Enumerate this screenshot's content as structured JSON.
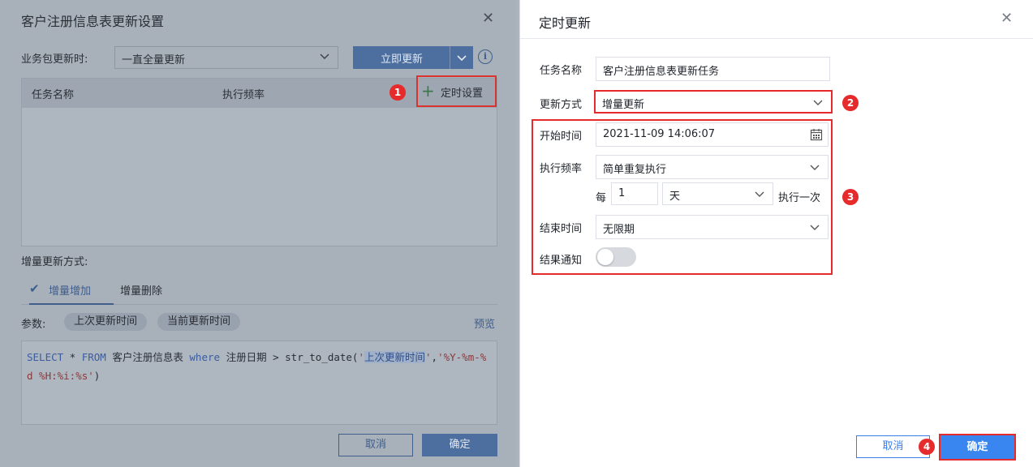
{
  "left_dialog": {
    "title": "客户注册信息表更新设置",
    "update_label": "业务包更新时:",
    "update_select_value": "一直全量更新",
    "update_now_label": "立即更新",
    "info_icon": "info-circle-icon",
    "table": {
      "columns": [
        "任务名称",
        "执行频率"
      ],
      "schedule_label": "定时设置"
    },
    "incremental_label": "增量更新方式:",
    "tabs": [
      {
        "label": "增量增加",
        "active": true
      },
      {
        "label": "增量删除",
        "active": false
      }
    ],
    "params_label": "参数:",
    "param_chips": [
      "上次更新时间",
      "当前更新时间"
    ],
    "preview_label": "预览",
    "sql": {
      "select": "SELECT",
      "star": " * ",
      "from": "FROM",
      "table": " 客户注册信息表 ",
      "where": "where",
      "condition": " 注册日期 > str_to_date(",
      "quote_open": "'",
      "param": "上次更新时间",
      "quote_close": "'",
      "comma": ",",
      "format": "'%Y-%m-%d %H:%i:%s'",
      "close": ")"
    },
    "cancel_label": "取消",
    "ok_label": "确定"
  },
  "right_dialog": {
    "title": "定时更新",
    "task_name_label": "任务名称",
    "task_name_value": "客户注册信息表更新任务",
    "update_mode_label": "更新方式",
    "update_mode_value": "增量更新",
    "start_time_label": "开始时间",
    "start_time_value": "2021-11-09 14:06:07",
    "frequency_label": "执行频率",
    "frequency_value": "简单重复执行",
    "every_label": "每",
    "every_value": "1",
    "unit_value": "天",
    "execute_once_label": "执行一次",
    "end_time_label": "结束时间",
    "end_time_value": "无限期",
    "notify_label": "结果通知",
    "notify_enabled": false,
    "cancel_label": "取消",
    "ok_label": "确定"
  },
  "markers": [
    "1",
    "2",
    "3",
    "4"
  ],
  "colors": {
    "accent": "#3a86f0",
    "highlight_red": "#e52b2b",
    "overlay": "#a8b0ba"
  }
}
